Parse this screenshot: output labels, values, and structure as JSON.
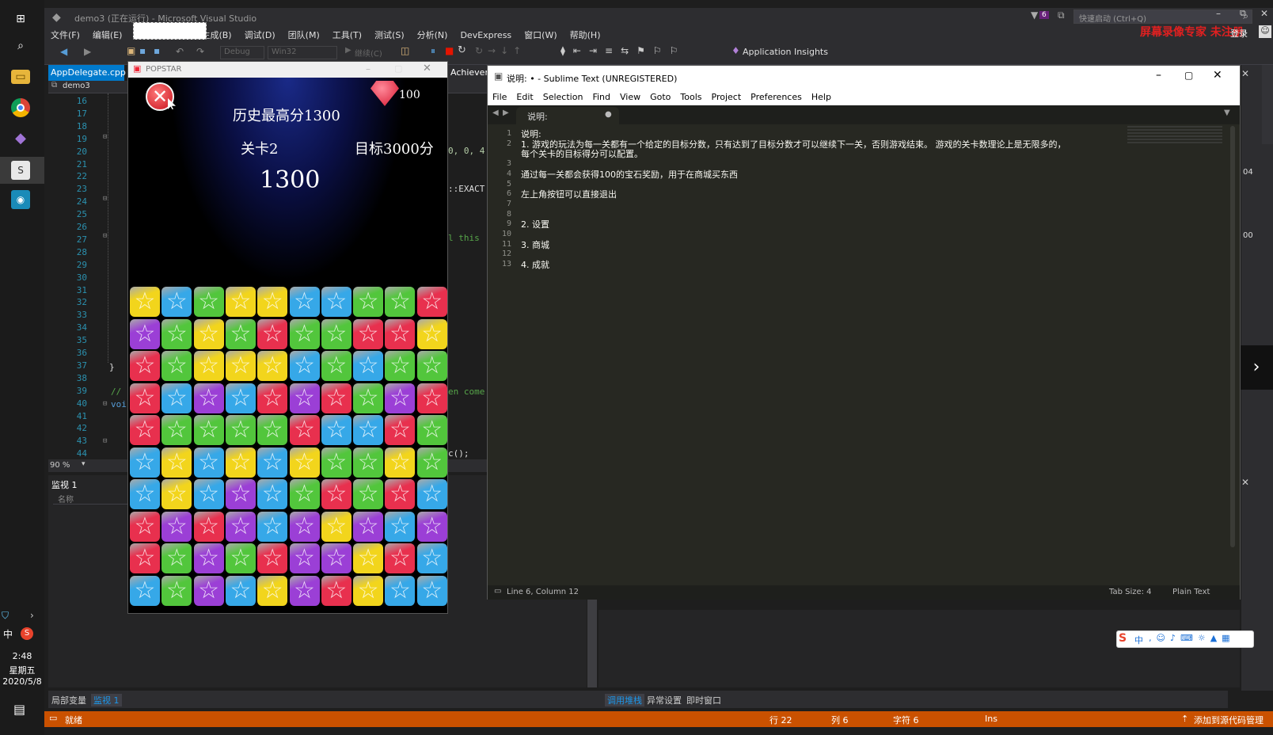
{
  "vs": {
    "title": "demo3 (正在运行) - Microsoft Visual Studio",
    "quick_launch": "快速启动 (Ctrl+Q)",
    "notification_count": "6",
    "watermark": "屏幕录像专家 未注册",
    "login": "登录",
    "menu": [
      "文件(F)",
      "编辑(E)",
      "生成(B)",
      "调试(D)",
      "团队(M)",
      "工具(T)",
      "测试(S)",
      "分析(N)",
      "DevExpress",
      "窗口(W)",
      "帮助(H)"
    ],
    "toolbar": {
      "config": "Debug",
      "platform": "Win32",
      "continue": "继续(C)",
      "app_insights": "Application Insights"
    },
    "tabs": {
      "file": "AppDelegate.cpp",
      "project": "demo3",
      "achievement": "Achievem"
    },
    "line_numbers": [
      "16",
      "17",
      "18",
      "19",
      "20",
      "21",
      "22",
      "23",
      "24",
      "25",
      "26",
      "27",
      "28",
      "29",
      "30",
      "31",
      "32",
      "33",
      "34",
      "35",
      "36",
      "37",
      "38",
      "39",
      "40",
      "41",
      "42",
      "43",
      "44"
    ],
    "code_fragments": {
      "l20": "0, 0, 4",
      "l23": "::EXACT",
      "l27": "l this",
      "l37": "}",
      "l39a": "//",
      "l39b": "en come",
      "l40": "voi",
      "l44": "c();"
    },
    "zoom": "90 %",
    "right_numbers": [
      "04",
      "00"
    ],
    "watch": {
      "title": "监视 1",
      "col_name": "名称"
    },
    "bottom_tabs_left": [
      "局部变量",
      "监视 1"
    ],
    "bottom_tabs_right": [
      "调用堆栈",
      "异常设置",
      "即时窗口"
    ],
    "status": {
      "ready": "就绪",
      "row": "行 22",
      "col": "列 6",
      "char": "字符 6",
      "ins": "Ins",
      "scm": "添加到源代码管理"
    }
  },
  "taskbar": {
    "time": "2:48",
    "weekday": "星期五",
    "date": "2020/5/8",
    "ime": "中"
  },
  "game": {
    "window_title": "POPSTAR",
    "gems": "100",
    "high_score": "历史最高分1300",
    "level": "关卡2",
    "target": "目标3000分",
    "score": "1300",
    "board": [
      [
        "Y",
        "B",
        "G",
        "Y",
        "Y",
        "B",
        "B",
        "G",
        "G",
        "R"
      ],
      [
        "P",
        "G",
        "Y",
        "G",
        "R",
        "G",
        "G",
        "R",
        "R",
        "Y"
      ],
      [
        "R",
        "G",
        "Y",
        "Y",
        "Y",
        "B",
        "G",
        "B",
        "G",
        "G"
      ],
      [
        "R",
        "B",
        "P",
        "B",
        "R",
        "P",
        "R",
        "G",
        "P",
        "R"
      ],
      [
        "R",
        "G",
        "G",
        "G",
        "G",
        "R",
        "B",
        "B",
        "R",
        "G"
      ],
      [
        "B",
        "Y",
        "B",
        "Y",
        "B",
        "Y",
        "G",
        "G",
        "Y",
        "G"
      ],
      [
        "B",
        "Y",
        "B",
        "P",
        "B",
        "G",
        "R",
        "G",
        "R",
        "B"
      ],
      [
        "R",
        "P",
        "R",
        "P",
        "B",
        "P",
        "Y",
        "P",
        "B",
        "P"
      ],
      [
        "R",
        "G",
        "P",
        "G",
        "R",
        "P",
        "P",
        "Y",
        "R",
        "B"
      ],
      [
        "B",
        "G",
        "P",
        "B",
        "Y",
        "P",
        "R",
        "Y",
        "B",
        "B"
      ]
    ],
    "colors": {
      "R": "#e8304e",
      "G": "#52c63c",
      "B": "#36a8e8",
      "Y": "#f2d51c",
      "P": "#9b3fd6"
    }
  },
  "sublime": {
    "title": "说明: • - Sublime Text (UNREGISTERED)",
    "menu": [
      "File",
      "Edit",
      "Selection",
      "Find",
      "View",
      "Goto",
      "Tools",
      "Project",
      "Preferences",
      "Help"
    ],
    "tab": "说明:",
    "lines": [
      {
        "n": "1",
        "t": "说明:"
      },
      {
        "n": "2",
        "t": "1.  游戏的玩法为每一关都有一个给定的目标分数，只有达到了目标分数才可以继续下一关，否则游戏结束。 游戏的关卡数理论上是无限多的，"
      },
      {
        "n": "",
        "t": "每个关卡的目标得分可以配置。"
      },
      {
        "n": "3",
        "t": ""
      },
      {
        "n": "4",
        "t": "通过每一关都会获得100的宝石奖励，用于在商城买东西"
      },
      {
        "n": "5",
        "t": ""
      },
      {
        "n": "6",
        "t": "左上角按钮可以直接退出"
      },
      {
        "n": "7",
        "t": ""
      },
      {
        "n": "8",
        "t": ""
      },
      {
        "n": "9",
        "t": "2. 设置"
      },
      {
        "n": "10",
        "t": ""
      },
      {
        "n": "11",
        "t": "3. 商城"
      },
      {
        "n": "12",
        "t": ""
      },
      {
        "n": "13",
        "t": "4. 成就"
      }
    ],
    "status": {
      "position": "Line 6, Column 12",
      "tab_size": "Tab Size: 4",
      "syntax": "Plain Text"
    }
  },
  "ime_bar": {
    "mode": "中"
  }
}
